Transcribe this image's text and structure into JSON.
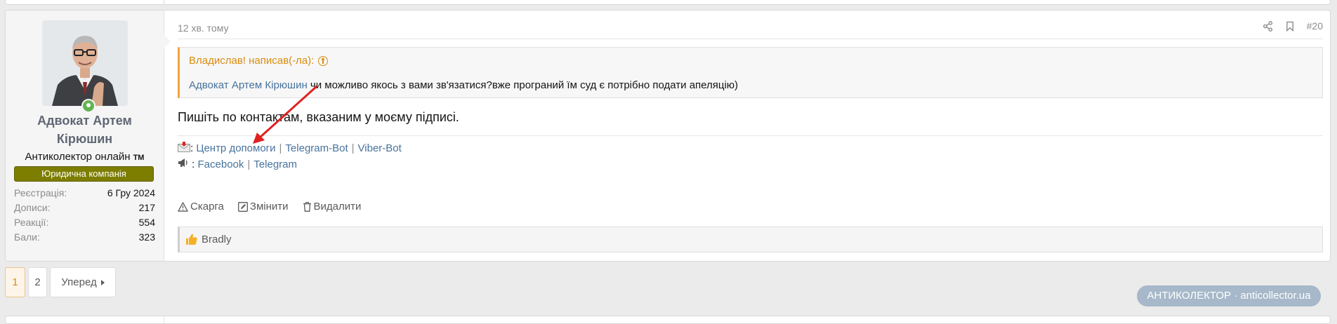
{
  "post": {
    "author": {
      "name": "Адвокат Артем Кірюшин",
      "title": "Антиколектор онлайн",
      "title_badge": "TM",
      "banner": "Юридична компанія",
      "stats": [
        {
          "label": "Реєстрація:",
          "value": "6 Гру 2024"
        },
        {
          "label": "Дописи:",
          "value": "217"
        },
        {
          "label": "Реакції:",
          "value": "554"
        },
        {
          "label": "Бали:",
          "value": "323"
        }
      ]
    },
    "date": "12 хв. тому",
    "post_number": "#20",
    "quote": {
      "header": "Владислав! написав(-ла):",
      "mention": "Адвокат Артем Кірюшин",
      "text": " чи можливо якось з вами зв'язатися?вже програний їм суд є потрібно подати апеляцію)"
    },
    "message": "Пишіть по контактам, вказаним у моєму підписі.",
    "signature": {
      "line1_links": [
        "Центр допомоги",
        "Telegram-Bot",
        "Viber-Bot"
      ],
      "line2_links": [
        "Facebook",
        "Telegram"
      ]
    },
    "actions": {
      "report": "Скарга",
      "edit": "Змінити",
      "delete": "Видалити"
    },
    "reactions": {
      "names": "Bradly"
    }
  },
  "pagination": {
    "pages": [
      "1",
      "2"
    ],
    "current": "1",
    "next": "Уперед"
  },
  "watermark": "АНТИКОЛЕКТОР · anticollector.ua",
  "colors": {
    "accent": "#d98c0f",
    "link": "#47739e",
    "banner": "#7d7d00",
    "online": "#63b450",
    "annotation_arrow": "#e02020"
  },
  "icons": [
    "share-icon",
    "bookmark-icon",
    "warning-icon",
    "edit-icon",
    "trash-icon",
    "thumbs-up-icon",
    "mail-icon",
    "megaphone-icon",
    "chevron-right-icon"
  ]
}
